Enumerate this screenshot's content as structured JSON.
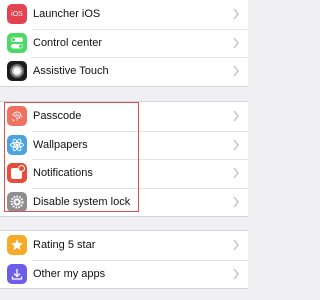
{
  "group_top": {
    "items": [
      {
        "label": "Launcher iOS",
        "icon": "ios-launcher-icon",
        "color": "#e2434f",
        "icon_text": "iOS"
      },
      {
        "label": "Control center",
        "icon": "toggle-switches-icon",
        "color": "#4cd964"
      },
      {
        "label": "Assistive Touch",
        "icon": "assistive-touch-icon",
        "color": "#1c1c1e"
      }
    ]
  },
  "group_middle": {
    "items": [
      {
        "label": "Passcode",
        "icon": "fingerprint-icon",
        "color": "#f0715f"
      },
      {
        "label": "Wallpapers",
        "icon": "atom-icon",
        "color": "#4aa3df"
      },
      {
        "label": "Notifications",
        "icon": "notification-badge-icon",
        "color": "#e74c3c"
      },
      {
        "label": "Disable system lock",
        "icon": "gear-icon",
        "color": "#8e8e93"
      }
    ]
  },
  "group_bottom": {
    "items": [
      {
        "label": "Rating 5 star",
        "icon": "star-icon",
        "color": "#f7a928"
      },
      {
        "label": "Other my apps",
        "icon": "download-icon",
        "color": "#6d5ee8"
      }
    ]
  },
  "highlight_color": "#d9534f"
}
